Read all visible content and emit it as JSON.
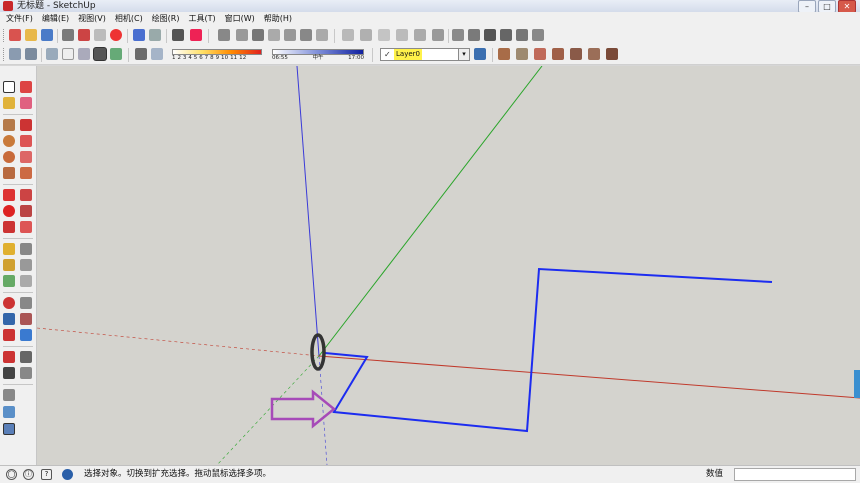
{
  "window": {
    "title": "无标题 - SketchUp",
    "app_icon": "sketchup-logo-icon",
    "minimize_glyph": "–",
    "maximize_glyph": "□",
    "close_glyph": "✕"
  },
  "menu": [
    "文件(F)",
    "编辑(E)",
    "视图(V)",
    "相机(C)",
    "绘图(R)",
    "工具(T)",
    "窗口(W)",
    "帮助(H)"
  ],
  "toolbars": {
    "shadow_scale_numbers": "1 2 3 4 5 6 7 8 9 10 11 12",
    "time_start": "06:55",
    "time_mid": "中午",
    "time_end": "17:00",
    "layer": "Layer0",
    "layer_check": "✓",
    "dropdown_arrow": "▾"
  },
  "status": {
    "message": "选择对象。切换到扩充选择。拖动鼠标选择多项。",
    "value_label": "数值",
    "value": "",
    "geo_glyph": "◯",
    "credit_glyph": "ⓘ",
    "user_glyph": "?"
  },
  "scene": {
    "red_axis_color": "#c0392b",
    "green_axis_color": "#2aa52a",
    "blue_axis_color": "#3a3ad8",
    "drawn_path_color": "#1c2cf0",
    "arrow_color": "#a64ab8",
    "scale_figure": "person-ring"
  }
}
